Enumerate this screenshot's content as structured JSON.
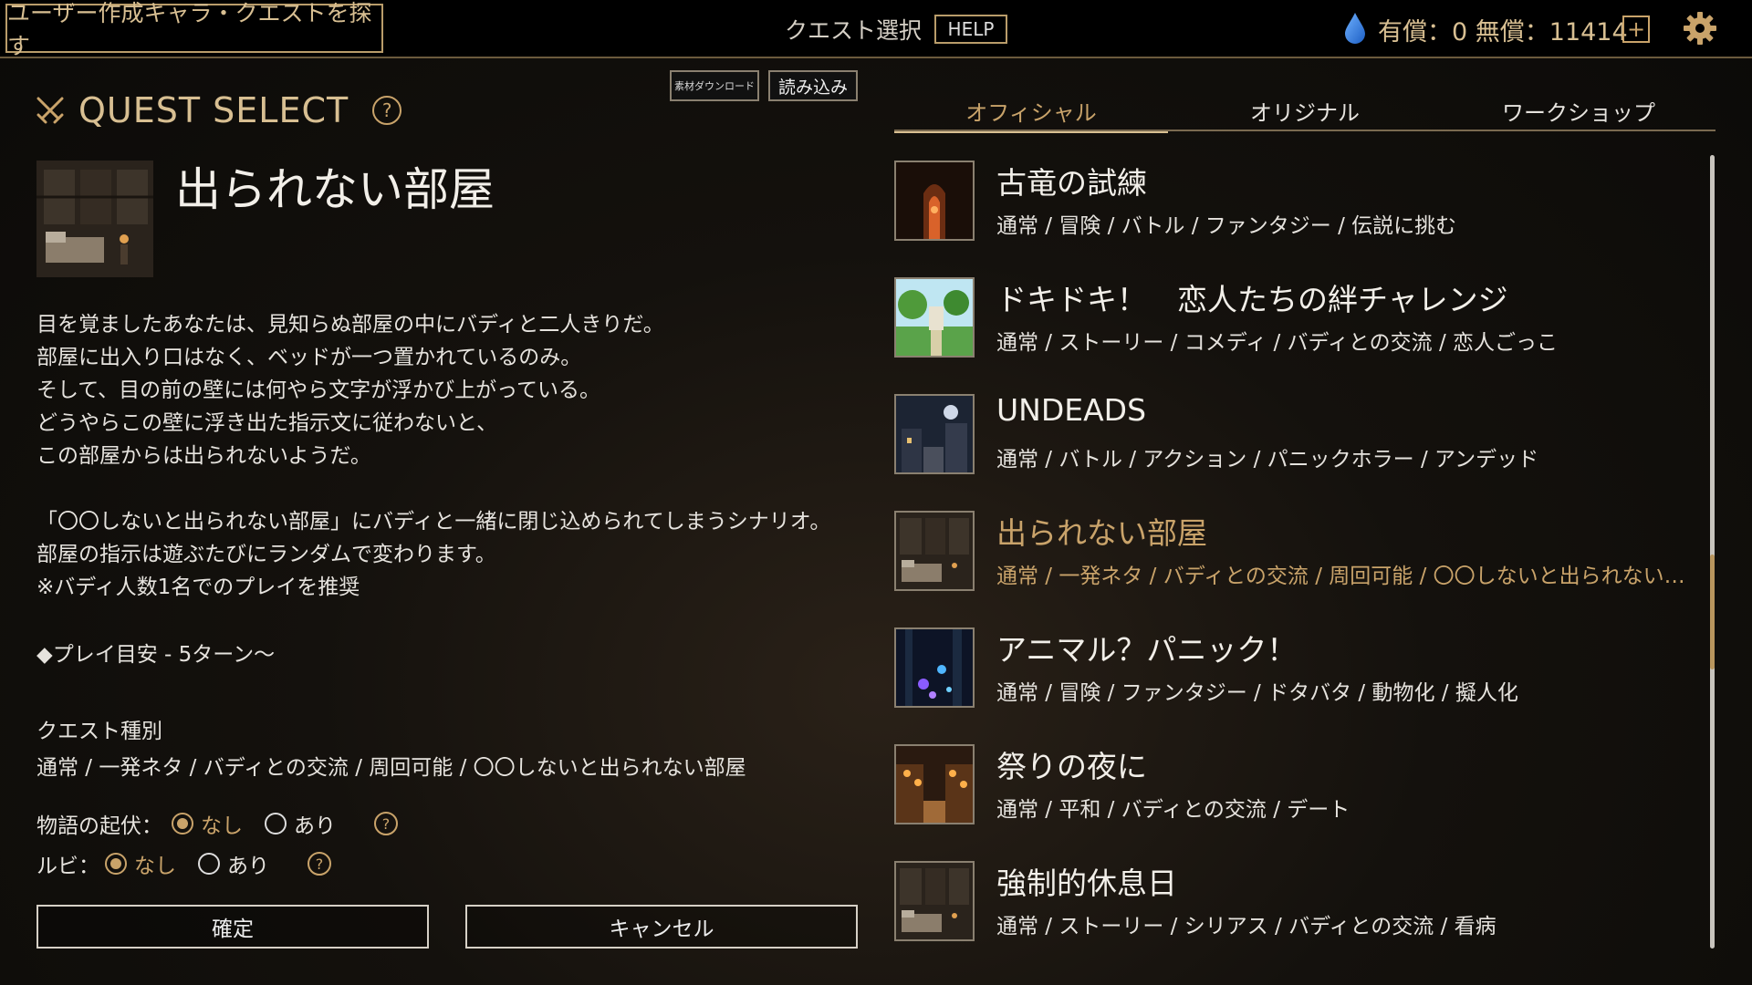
{
  "topbar": {
    "user_quest_button": "ユーザー作成キャラ・クエストを探す",
    "screen_title": "クエスト選択",
    "help_button": "HELP",
    "currency": "有償：0 無償：11414",
    "add_button": "+"
  },
  "left": {
    "header_title": "QUEST SELECT",
    "help_glyph": "?",
    "material_download_button": "素材ダウンロード",
    "load_button": "読み込み",
    "detail": {
      "title": "出られない部屋",
      "description": [
        "目を覚ましたあなたは、見知らぬ部屋の中にバディと二人きりだ。\n部屋に出入り口はなく、ベッドが一つ置かれているのみ。\nそして、目の前の壁には何やら文字が浮かび上がっている。\nどうやらこの壁に浮き出た指示文に従わないと、\nこの部屋からは出られないようだ。",
        "「〇〇しないと出られない部屋」にバディと一緒に閉じ込められてしまうシナリオ。部屋の指示は遊ぶたびにランダムで変わります。\n※バディ人数1名でのプレイを推奨"
      ],
      "play_guide": "◆プレイ目安 - 5ターン～",
      "type_label": "クエスト種別",
      "type_value": "通常 / 一発ネタ / バディとの交流 / 周回可能 / 〇〇しないと出られない部屋"
    },
    "options": {
      "story": {
        "label": "物語の起伏：",
        "choices": [
          "なし",
          "あり"
        ],
        "selected": "なし"
      },
      "ruby": {
        "label": "ルビ：",
        "choices": [
          "なし",
          "あり"
        ],
        "selected": "なし"
      }
    },
    "confirm_button": "確定",
    "cancel_button": "キャンセル"
  },
  "right": {
    "tabs": [
      {
        "label": "オフィシャル",
        "active": true
      },
      {
        "label": "オリジナル",
        "active": false
      },
      {
        "label": "ワークショップ",
        "active": false
      }
    ],
    "quests": [
      {
        "title": "古竜の試練",
        "tags": "通常 / 冒険 / バトル / ファンタジー / 伝説に挑む",
        "selected": false,
        "thumb_icon": "ancient-dragon-thumbnail"
      },
      {
        "title": "ドキドキ！　恋人たちの絆チャレンジ",
        "tags": "通常 / ストーリー / コメディ / バディとの交流 / 恋人ごっこ",
        "selected": false,
        "thumb_icon": "garden-thumbnail"
      },
      {
        "title": "UNDEADS",
        "tags": "通常 / バトル / アクション / パニックホラー / アンデッド",
        "selected": false,
        "thumb_icon": "night-town-thumbnail"
      },
      {
        "title": "出られない部屋",
        "tags": "通常 / 一発ネタ / バディとの交流 / 周回可能 / 〇〇しないと出られない部屋",
        "selected": true,
        "thumb_icon": "bedroom-thumbnail"
      },
      {
        "title": "アニマル？パニック！",
        "tags": "通常 / 冒険 / ファンタジー / ドタバタ / 動物化 / 擬人化",
        "selected": false,
        "thumb_icon": "magic-forest-thumbnail"
      },
      {
        "title": "祭りの夜に",
        "tags": "通常 / 平和 / バディとの交流 / デート",
        "selected": false,
        "thumb_icon": "festival-thumbnail"
      },
      {
        "title": "強制的休息日",
        "tags": "通常 / ストーリー / シリアス / バディとの交流 / 看病",
        "selected": false,
        "thumb_icon": "bedroom-thumbnail"
      }
    ]
  },
  "colors": {
    "accent": "#c9a36a",
    "text": "#e6e3de",
    "background": "#14110d"
  }
}
